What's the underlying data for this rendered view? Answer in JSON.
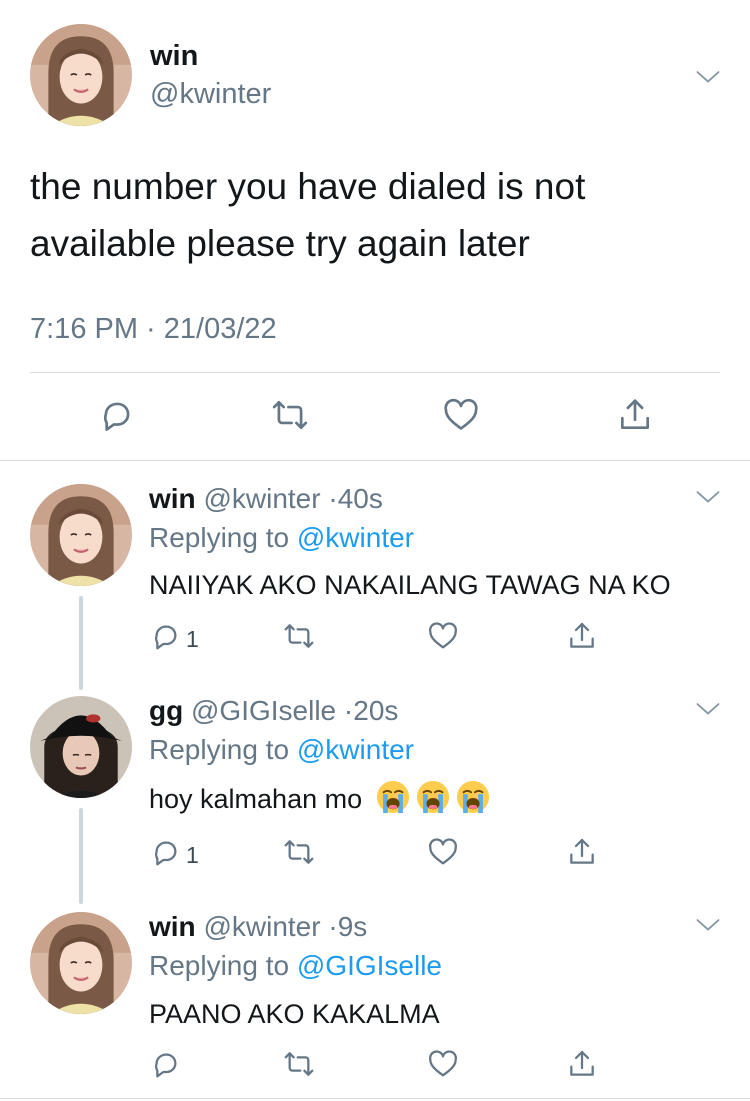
{
  "main_tweet": {
    "name": "win",
    "handle": "@kwinter",
    "text": "the number you have dialed is not available please try again later",
    "timestamp": "7:16 PM · 21/03/22",
    "actions": [
      "reply-icon",
      "retweet-icon",
      "like-icon",
      "share-icon"
    ]
  },
  "replies": [
    {
      "name": "win",
      "handle": "@kwinter",
      "dot": "·",
      "time": "40s",
      "replying_prefix": "Replying to ",
      "replying_to": "@kwinter",
      "text": "NAIIYAK AKO NAKAILANG TAWAG NA KO",
      "reply_count": "1",
      "avatar": "winter-avatar"
    },
    {
      "name": "gg",
      "handle": "@GIGIselle",
      "dot": "·",
      "time": "20s",
      "replying_prefix": "Replying to ",
      "replying_to": "@kwinter",
      "text": "hoy kalmahan mo",
      "emojis": [
        "loudly-crying-face",
        "loudly-crying-face",
        "loudly-crying-face"
      ],
      "reply_count": "1",
      "avatar": "giselle-avatar"
    },
    {
      "name": "win",
      "handle": "@kwinter",
      "dot": "·",
      "time": "9s",
      "replying_prefix": "Replying to ",
      "replying_to": "@GIGIselle",
      "text": "PAANO AKO KAKALMA",
      "reply_count": "",
      "avatar": "winter-avatar"
    }
  ],
  "colors": {
    "link": "#1d9bf0",
    "secondary_text": "#657786",
    "divider": "#d6dce1",
    "icon": "#657786"
  }
}
